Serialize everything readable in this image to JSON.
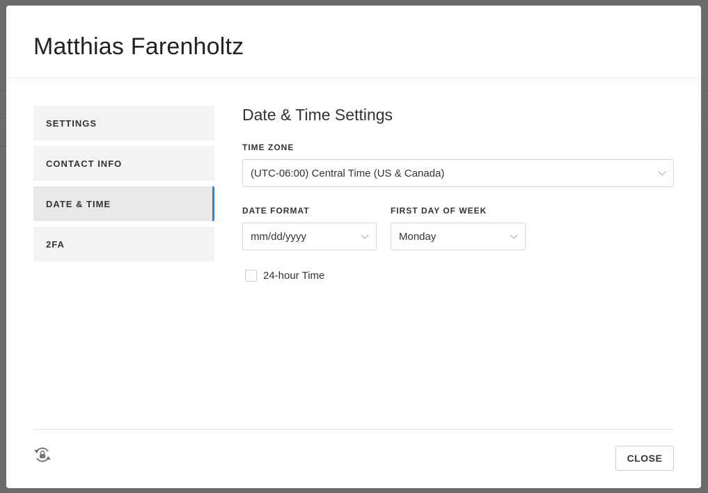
{
  "modal": {
    "title": "Matthias Farenholtz"
  },
  "nav": {
    "items": [
      {
        "label": "SETTINGS"
      },
      {
        "label": "CONTACT INFO"
      },
      {
        "label": "DATE & TIME"
      },
      {
        "label": "2FA"
      }
    ],
    "active": "DATE & TIME"
  },
  "content": {
    "heading": "Date & Time Settings",
    "time_zone": {
      "label": "TIME ZONE",
      "value": "(UTC-06:00) Central Time (US & Canada)"
    },
    "date_format": {
      "label": "DATE FORMAT",
      "value": "mm/dd/yyyy"
    },
    "first_day": {
      "label": "FIRST DAY OF WEEK",
      "value": "Monday"
    },
    "hour24": {
      "label": "24-hour Time",
      "checked": false
    }
  },
  "footer": {
    "close_label": "CLOSE",
    "reset_icon": "lock-reset-icon"
  },
  "colors": {
    "accent": "#1e88e5"
  }
}
